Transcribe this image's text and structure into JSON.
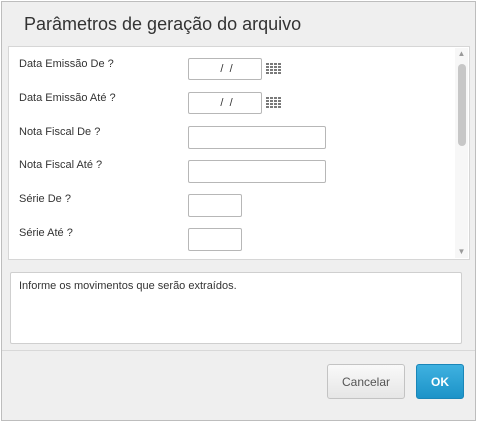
{
  "dialog": {
    "title": "Parâmetros de geração do arquivo"
  },
  "fields": [
    {
      "label": "Data Emissão De ?",
      "value": " /  /",
      "type": "date",
      "icon": "calendar-icon"
    },
    {
      "label": "Data Emissão Até ?",
      "value": " /  /",
      "type": "date",
      "icon": "calendar-icon"
    },
    {
      "label": "Nota Fiscal De ?",
      "value": "",
      "type": "text"
    },
    {
      "label": "Nota Fiscal Até ?",
      "value": "",
      "type": "text"
    },
    {
      "label": "Série De ?",
      "value": "",
      "type": "text"
    },
    {
      "label": "Série Até ?",
      "value": "",
      "type": "text"
    }
  ],
  "scrollbar": {
    "up_glyph": "▲",
    "down_glyph": "▼"
  },
  "help": {
    "text": "Informe os movimentos que serão extraídos."
  },
  "buttons": {
    "cancel_label": "Cancelar",
    "ok_label": "OK"
  },
  "colors": {
    "ok_button": "#1c93c8",
    "dialog_background": "#efefef"
  }
}
